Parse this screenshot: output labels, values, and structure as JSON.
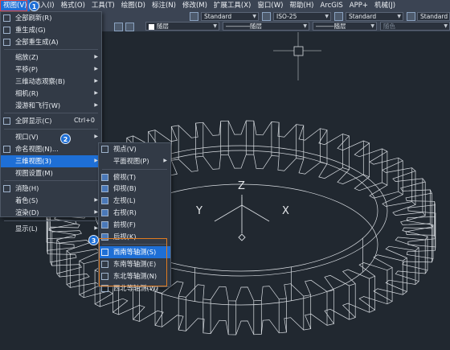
{
  "menubar": {
    "items": [
      "视图(V)",
      "插入(I)",
      "格式(O)",
      "工具(T)",
      "绘图(D)",
      "标注(N)",
      "修改(M)",
      "扩展工具(X)",
      "窗口(W)",
      "帮助(H)",
      "ArcGIS",
      "APP+",
      "机械(J)"
    ]
  },
  "toolbar": {
    "style1": "Standard",
    "style2": "ISO-25",
    "style3": "Standard",
    "style4": "Standard",
    "layer": "随层",
    "linetype": "随层",
    "lineweight": "随层",
    "color": "随色"
  },
  "view_menu": {
    "items": [
      {
        "label": "全部刷新(R)",
        "icon": "redraw-icon"
      },
      {
        "label": "重生成(G)",
        "icon": "regen-icon"
      },
      {
        "label": "全部重生成(A)",
        "icon": "regenall-icon"
      },
      {
        "label": "缩放(Z)",
        "submenu": true
      },
      {
        "label": "平移(P)",
        "submenu": true
      },
      {
        "label": "三维动态观察(B)",
        "submenu": true
      },
      {
        "label": "相机(R)",
        "submenu": true
      },
      {
        "label": "漫游和飞行(W)",
        "submenu": true
      },
      {
        "label": "全屏显示(C)",
        "shortcut": "Ctrl+0",
        "icon": "fullscreen-icon"
      },
      {
        "label": "视口(V)",
        "submenu": true
      },
      {
        "label": "命名视图(N)...",
        "icon": "named-view-icon"
      },
      {
        "label": "三维视图(3)",
        "submenu": true
      },
      {
        "label": "视图设置(M)"
      },
      {
        "label": "消隐(H)",
        "icon": "hide-icon"
      },
      {
        "label": "着色(S)",
        "submenu": true
      },
      {
        "label": "渲染(D)",
        "submenu": true
      },
      {
        "label": "显示(L)",
        "submenu": true
      }
    ]
  },
  "view3d_menu": {
    "items": [
      {
        "label": "视点(V)",
        "icon": "viewpoint-icon"
      },
      {
        "label": "平面视图(P)",
        "submenu": true
      },
      {
        "label": "俯视(T)",
        "icon": "top-view-icon"
      },
      {
        "label": "仰视(B)",
        "icon": "bottom-view-icon"
      },
      {
        "label": "左视(L)",
        "icon": "left-view-icon"
      },
      {
        "label": "右视(R)",
        "icon": "right-view-icon"
      },
      {
        "label": "前视(F)",
        "icon": "front-view-icon"
      },
      {
        "label": "后视(K)",
        "icon": "back-view-icon"
      },
      {
        "label": "西南等轴测(S)",
        "icon": "sw-iso-icon"
      },
      {
        "label": "东南等轴测(E)",
        "icon": "se-iso-icon"
      },
      {
        "label": "东北等轴测(N)",
        "icon": "ne-iso-icon"
      },
      {
        "label": "西北等轴测(W)",
        "icon": "nw-iso-icon"
      }
    ]
  },
  "steps": {
    "one": "1",
    "two": "2",
    "three": "3"
  },
  "axes": {
    "x": "X",
    "y": "Y",
    "z": "Z"
  },
  "colors": {
    "menubar": "#3b4453",
    "highlight": "#1e6fd6",
    "canvas": "#212830",
    "annotation": "#e07b1f",
    "red_box": "#e04343"
  }
}
